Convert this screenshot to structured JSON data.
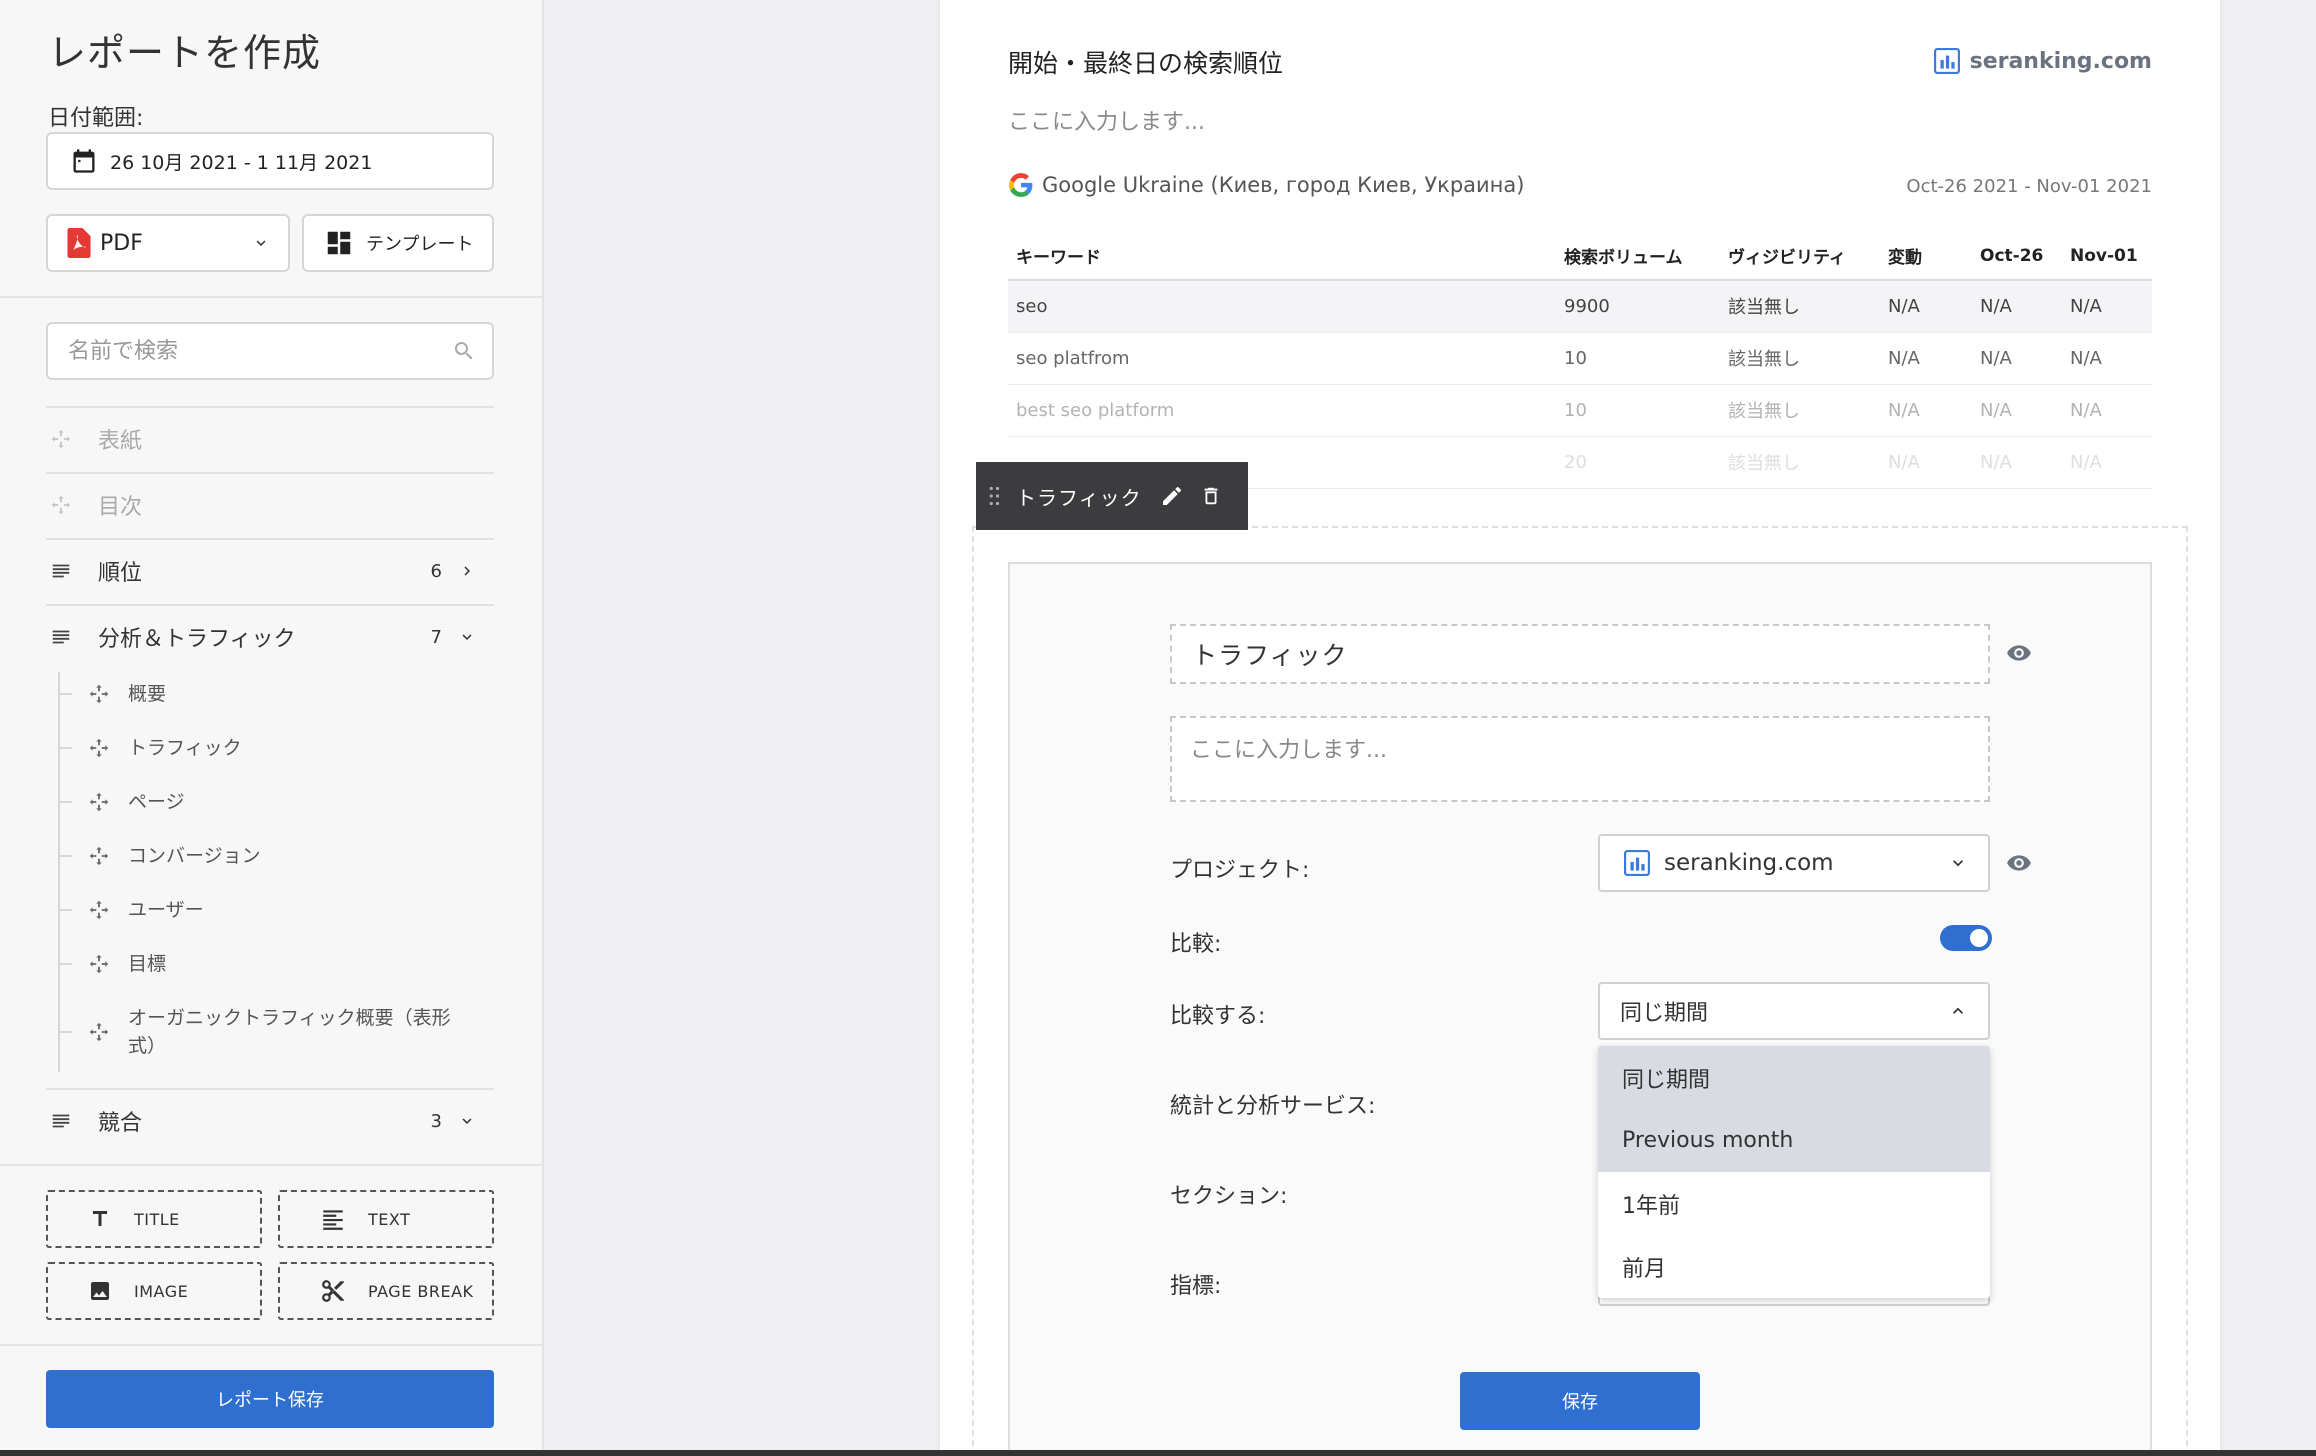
{
  "sidebar": {
    "title": "レポートを作成",
    "date_label": "日付範囲:",
    "date_value": "26 10月 2021 - 1 11月 2021",
    "format_label": "PDF",
    "template_label": "テンプレート",
    "search_placeholder": "名前で検索",
    "items": [
      {
        "label": "表紙",
        "disabled": true,
        "icon": "drag-move-icon"
      },
      {
        "label": "目次",
        "disabled": true,
        "icon": "drag-move-icon"
      },
      {
        "label": "順位",
        "count": "6",
        "icon": "list-icon",
        "arrow": "chevron-right-icon"
      },
      {
        "label": "分析＆トラフィック",
        "count": "7",
        "icon": "list-icon",
        "arrow": "chevron-down-icon"
      },
      {
        "label": "競合",
        "count": "3",
        "icon": "list-icon",
        "arrow": "chevron-down-icon"
      }
    ],
    "subitems": [
      {
        "label": "概要"
      },
      {
        "label": "トラフィック"
      },
      {
        "label": "ページ"
      },
      {
        "label": "コンバージョン"
      },
      {
        "label": "ユーザー"
      },
      {
        "label": "目標"
      },
      {
        "label": "オーガニックトラフィック概要（表形式）"
      }
    ],
    "blocks": [
      {
        "label": "TITLE",
        "icon": "title-icon"
      },
      {
        "label": "TEXT",
        "icon": "text-icon"
      },
      {
        "label": "IMAGE",
        "icon": "image-icon"
      },
      {
        "label": "PAGE BREAK",
        "icon": "scissors-icon"
      }
    ],
    "save_label": "レポート保存"
  },
  "report": {
    "title": "開始・最終日の検索順位",
    "brand": "seranking.com",
    "description": "ここに入力します...",
    "engine": "Google Ukraine (Киев, город Киев, Украина)",
    "date_range": "Oct-26 2021 - Nov-01 2021",
    "table": {
      "headers": [
        "キーワード",
        "検索ボリューム",
        "ヴィジビリティ",
        "変動",
        "Oct-26",
        "Nov-01"
      ],
      "rows": [
        [
          "seo",
          "9900",
          "該当無し",
          "N/A",
          "N/A",
          "N/A"
        ],
        [
          "seo platfrom",
          "10",
          "該当無し",
          "N/A",
          "N/A",
          "N/A"
        ],
        [
          "best seo platform",
          "10",
          "該当無し",
          "N/A",
          "N/A",
          "N/A"
        ],
        [
          "",
          "20",
          "該当無し",
          "N/A",
          "N/A",
          "N/A"
        ]
      ]
    }
  },
  "section_toolbar": {
    "label": "トラフィック"
  },
  "section_editor": {
    "title_value": "トラフィック",
    "desc_placeholder": "ここに入力します...",
    "project_label": "プロジェクト:",
    "project_value": "seranking.com",
    "compare_label": "比較:",
    "compare_on": true,
    "compare_with_label": "比較する:",
    "compare_with_value": "同じ期間",
    "dropdown_options": [
      "同じ期間",
      "Previous month",
      "1年前",
      "前月"
    ],
    "analytics_label": "統計と分析サービス:",
    "section_label": "セクション:",
    "metrics_label": "指標:",
    "save_label": "保存"
  },
  "colors": {
    "accent": "#2f6fd0",
    "toolbar_bg": "#3c3c3e",
    "dropdown_highlight": "#d9dbe2"
  }
}
